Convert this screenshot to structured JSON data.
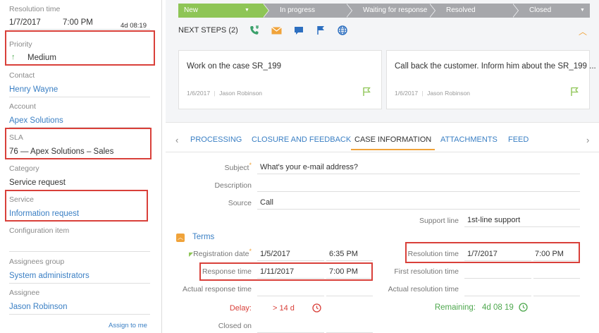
{
  "left": {
    "resolution_time": {
      "label": "Resolution time",
      "date": "1/7/2017",
      "time": "7:00 PM",
      "remaining": "4d 08:19"
    },
    "priority": {
      "label": "Priority",
      "value": "Medium"
    },
    "contact": {
      "label": "Contact",
      "value": "Henry Wayne"
    },
    "account": {
      "label": "Account",
      "value": "Apex Solutions"
    },
    "sla": {
      "label": "SLA",
      "value": "76 — Apex Solutions – Sales"
    },
    "category": {
      "label": "Category",
      "value": "Service request"
    },
    "service": {
      "label": "Service",
      "value": "Information request"
    },
    "configuration_item": {
      "label": "Configuration item",
      "value": ""
    },
    "assignees_group": {
      "label": "Assignees group",
      "value": "System administrators"
    },
    "assignee": {
      "label": "Assignee",
      "value": "Jason Robinson"
    },
    "assign_to_me": "Assign to me"
  },
  "stages": [
    "New",
    "In progress",
    "Waiting for response",
    "Resolved",
    "Closed"
  ],
  "next_steps": {
    "title": "NEXT STEPS (2)",
    "cards": [
      {
        "title": "Work on the case SR_199",
        "date": "1/6/2017",
        "owner": "Jason Robinson"
      },
      {
        "title": "Call back the customer. Inform him about the SR_199 ...",
        "date": "1/6/2017",
        "owner": "Jason Robinson"
      }
    ]
  },
  "tabs": [
    "PROCESSING",
    "CLOSURE AND FEEDBACK",
    "CASE INFORMATION",
    "ATTACHMENTS",
    "FEED"
  ],
  "case_info": {
    "subject_label": "Subject",
    "subject": "What's your e-mail address?",
    "description_label": "Description",
    "description": "",
    "source_label": "Source",
    "source": "Call",
    "support_line_label": "Support line",
    "support_line": "1st-line support"
  },
  "terms": {
    "title": "Terms",
    "registration_date_label": "Registration date",
    "registration_date": "1/5/2017",
    "registration_time": "6:35 PM",
    "response_time_label": "Response time",
    "response_date": "1/11/2017",
    "response_time": "7:00 PM",
    "actual_response_time_label": "Actual response time",
    "delay_label": "Delay:",
    "delay_value": "> 14 d",
    "closed_on_label": "Closed on",
    "resolution_time_label": "Resolution time",
    "resolution_date": "1/7/2017",
    "resolution_time": "7:00 PM",
    "first_resolution_time_label": "First resolution time",
    "actual_resolution_time_label": "Actual resolution time",
    "remaining_label": "Remaining:",
    "remaining_value": "4d 08 19"
  },
  "colors": {
    "accent": "#f0a33a",
    "link": "#3a7fc4",
    "stage_active": "#8ec556",
    "stage_inactive": "#a6a7ab",
    "highlight": "#d9403a",
    "delay": "#d9403a",
    "remaining": "#4fa84f"
  }
}
